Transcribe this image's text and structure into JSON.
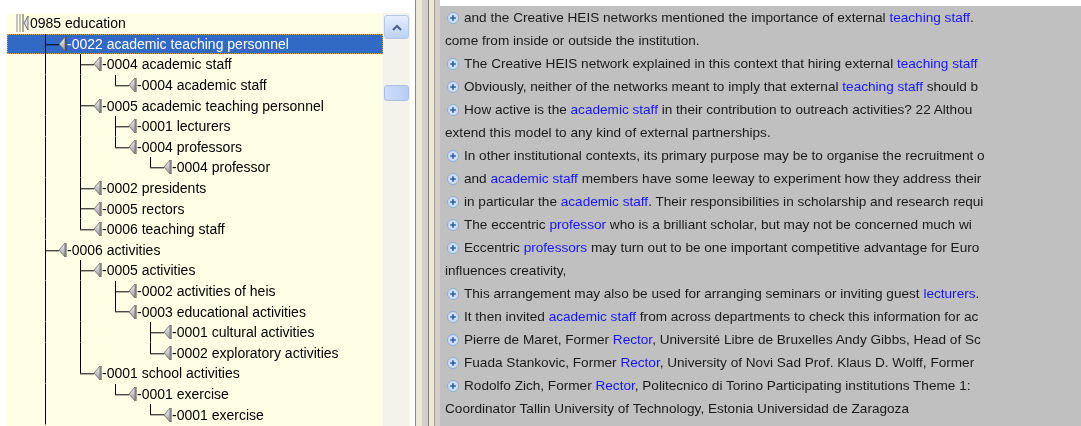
{
  "tree": {
    "label": "0985 education",
    "selected": false,
    "more": true,
    "children": [
      {
        "label": "-0022 academic teaching personnel",
        "selected": true,
        "children": [
          {
            "label": "-0004 academic staff",
            "selected": false,
            "children": [
              {
                "label": "-0004 academic staff",
                "selected": false
              }
            ]
          },
          {
            "label": "-0005 academic teaching personnel",
            "selected": false,
            "children": [
              {
                "label": "-0001 lecturers",
                "selected": false
              },
              {
                "label": "-0004 professors",
                "selected": false,
                "children": [
                  {
                    "label": "-0004 professor",
                    "selected": false
                  }
                ]
              }
            ]
          },
          {
            "label": "-0002 presidents",
            "selected": false
          },
          {
            "label": "-0005 rectors",
            "selected": false
          },
          {
            "label": "-0006 teaching staff",
            "selected": false
          }
        ]
      },
      {
        "label": "-0006 activities",
        "selected": false,
        "children": [
          {
            "label": "-0005 activities",
            "selected": false,
            "children": [
              {
                "label": "-0002 activities of heis",
                "selected": false
              },
              {
                "label": "-0003 educational activities",
                "selected": false,
                "children": [
                  {
                    "label": "-0001 cultural activities",
                    "selected": false
                  },
                  {
                    "label": "-0002 exploratory activities",
                    "selected": false
                  }
                ]
              }
            ]
          },
          {
            "label": "-0001 school activities",
            "selected": false,
            "children": [
              {
                "label": "-0001 exercise",
                "selected": false,
                "children": [
                  {
                    "label": "-0001 exercise",
                    "selected": false
                  }
                ]
              }
            ]
          }
        ]
      }
    ]
  },
  "results": [
    {
      "bullet": true,
      "parts": [
        {
          "text": " and the Creative HEIS networks mentioned the importance of external ",
          "link": false
        },
        {
          "text": "teaching staff",
          "link": true
        },
        {
          "text": ".",
          "link": false
        }
      ]
    },
    {
      "bullet": false,
      "parts": [
        {
          "text": "come from inside or outside the institution.",
          "link": false
        }
      ]
    },
    {
      "bullet": true,
      "parts": [
        {
          "text": "The Creative HEIS network explained in this context that hiring external ",
          "link": false
        },
        {
          "text": "teaching staff",
          "link": true
        }
      ]
    },
    {
      "bullet": true,
      "parts": [
        {
          "text": "Obviously, neither of the networks meant to imply that external ",
          "link": false
        },
        {
          "text": "teaching staff",
          "link": true
        },
        {
          "text": " should b",
          "link": false
        }
      ]
    },
    {
      "bullet": true,
      "parts": [
        {
          "text": "How active is the ",
          "link": false
        },
        {
          "text": "academic staff",
          "link": true
        },
        {
          "text": " in their contribution to outreach activities? 22 Althou",
          "link": false
        }
      ]
    },
    {
      "bullet": false,
      "parts": [
        {
          "text": "extend this model to any kind of external partnerships.",
          "link": false
        }
      ]
    },
    {
      "bullet": true,
      "parts": [
        {
          "text": "In other institutional contexts, its primary purpose may be to organise the recruitment o",
          "link": false
        }
      ]
    },
    {
      "bullet": true,
      "parts": [
        {
          "text": " and ",
          "link": false
        },
        {
          "text": "academic staff",
          "link": true
        },
        {
          "text": " members have some leeway to experiment how they address their",
          "link": false
        }
      ]
    },
    {
      "bullet": true,
      "parts": [
        {
          "text": "in particular the ",
          "link": false
        },
        {
          "text": "academic staff",
          "link": true
        },
        {
          "text": ". Their responsibilities in scholarship and research requi",
          "link": false
        }
      ]
    },
    {
      "bullet": true,
      "parts": [
        {
          "text": "The eccentric ",
          "link": false
        },
        {
          "text": "professor",
          "link": true
        },
        {
          "text": " who is a brilliant scholar,  but may not be concerned much wi",
          "link": false
        }
      ]
    },
    {
      "bullet": true,
      "parts": [
        {
          "text": "Eccentric ",
          "link": false
        },
        {
          "text": "professors",
          "link": true
        },
        {
          "text": " may turn out to be one important competitive advantage for Euro",
          "link": false
        }
      ]
    },
    {
      "bullet": false,
      "parts": [
        {
          "text": "influences creativity,",
          "link": false
        }
      ]
    },
    {
      "bullet": true,
      "parts": [
        {
          "text": "This arrangement may also be used for arranging seminars or inviting guest ",
          "link": false
        },
        {
          "text": "lecturers",
          "link": true
        },
        {
          "text": ".",
          "link": false
        }
      ]
    },
    {
      "bullet": true,
      "parts": [
        {
          "text": "It then invited ",
          "link": false
        },
        {
          "text": "academic staff",
          "link": true
        },
        {
          "text": " from across departments to check this information for ac",
          "link": false
        }
      ]
    },
    {
      "bullet": true,
      "parts": [
        {
          "text": "Pierre de Maret, Former ",
          "link": false
        },
        {
          "text": "Rector",
          "link": true
        },
        {
          "text": ", Université Libre de Bruxelles Andy Gibbs, Head of Sc",
          "link": false
        }
      ]
    },
    {
      "bullet": true,
      "parts": [
        {
          "text": "Fuada Stankovic, Former ",
          "link": false
        },
        {
          "text": "Rector",
          "link": true
        },
        {
          "text": ", University of Novi Sad Prof. Klaus D. Wolff, Former",
          "link": false
        }
      ]
    },
    {
      "bullet": true,
      "parts": [
        {
          "text": "Rodolfo Zich, Former ",
          "link": false
        },
        {
          "text": "Rector",
          "link": true
        },
        {
          "text": ", Politecnico di Torino Participating institutions Theme 1:",
          "link": false
        }
      ]
    },
    {
      "bullet": false,
      "parts": [
        {
          "text": "Coordinator Tallin University of Technology, Estonia Universidad de Zaragoza",
          "link": false
        }
      ]
    }
  ]
}
